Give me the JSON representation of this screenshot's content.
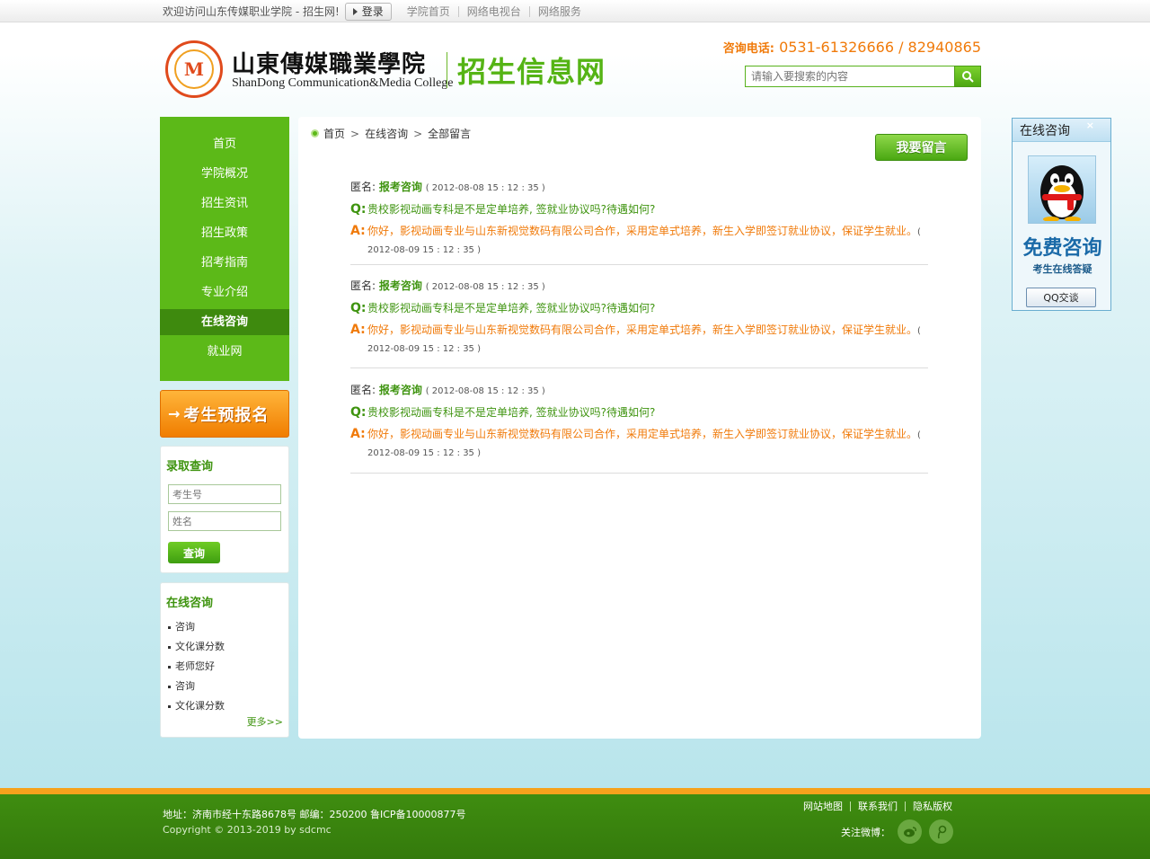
{
  "topbar": {
    "welcome": "欢迎访问山东传媒职业学院 - 招生网!",
    "login_label": "登录",
    "links": [
      "学院首页",
      "网络电视台",
      "网络服务"
    ]
  },
  "header": {
    "seal_glyph": "M",
    "college_cn": "山東傳媒職業學院",
    "college_en": "ShanDong Communication&Media College",
    "site_name": "招生信息网",
    "hotline_label": "咨询电话:",
    "hotline_numbers": "0531-61326666 / 82940865",
    "search_placeholder": "请输入要搜索的内容"
  },
  "nav": {
    "items": [
      "首页",
      "学院概况",
      "招生资讯",
      "招生政策",
      "招考指南",
      "专业介绍",
      "在线咨询",
      "就业网"
    ],
    "active": "在线咨询"
  },
  "signup_banner": {
    "arrow": "→",
    "label": "考生预报名"
  },
  "query_panel": {
    "title": "录取查询",
    "field1_placeholder": "考生号",
    "field2_placeholder": "姓名",
    "button": "查询"
  },
  "consult_panel": {
    "title": "在线咨询",
    "items": [
      "咨询",
      "文化课分数",
      "老师您好",
      "咨询",
      "文化课分数"
    ],
    "more": "更多>>"
  },
  "main": {
    "breadcrumb": [
      "首页",
      "在线咨询",
      "全部留言"
    ],
    "leave_message_label": "我要留言",
    "qa": [
      {
        "author": "匿名:",
        "topic": "报考咨询",
        "time": "( 2012-08-08 15 : 12 : 35 )",
        "q_mark": "Q:",
        "question": "贵校影视动画专科是不是定单培养, 签就业协议吗?待遇如何?",
        "a_mark": "A:",
        "answer": "你好，影视动画专业与山东新视觉数码有限公司合作，采用定单式培养，新生入学即签订就业协议，保证学生就业。",
        "answer_time": "( 2012-08-09 15 : 12 : 35 )"
      },
      {
        "author": "匿名:",
        "topic": "报考咨询",
        "time": "( 2012-08-08 15 : 12 : 35 )",
        "q_mark": "Q:",
        "question": "贵校影视动画专科是不是定单培养, 签就业协议吗?待遇如何?",
        "a_mark": "A:",
        "answer": "你好，影视动画专业与山东新视觉数码有限公司合作，采用定单式培养，新生入学即签订就业协议，保证学生就业。",
        "answer_time": "( 2012-08-09 15 : 12 : 35 )"
      },
      {
        "author": "匿名:",
        "topic": "报考咨询",
        "time": "( 2012-08-08 15 : 12 : 35 )",
        "q_mark": "Q:",
        "question": "贵校影视动画专科是不是定单培养, 签就业协议吗?待遇如何?",
        "a_mark": "A:",
        "answer": "你好，影视动画专业与山东新视觉数码有限公司合作，采用定单式培养，新生入学即签订就业协议，保证学生就业。",
        "answer_time": "( 2012-08-09 15 : 12 : 35 )"
      }
    ]
  },
  "qq_widget": {
    "title": "在线咨询",
    "close": "×",
    "free": "免费咨询",
    "sub": "考生在线答疑",
    "chat_button": "QQ交谈"
  },
  "footer": {
    "info": "地址：济南市经十东路8678号   邮编：250200   鲁ICP备10000877号",
    "copyright": "Copyright © 2013-2019 by sdcmc",
    "links": [
      "网站地图",
      "联系我们",
      "隐私版权"
    ],
    "follow": "关注微博：",
    "social": [
      "weibo-icon",
      "tencent-weibo-icon"
    ]
  },
  "colors": {
    "brand_green": "#5cb918",
    "accent_orange": "#f07a0a",
    "dark_green": "#3e8a0e"
  }
}
